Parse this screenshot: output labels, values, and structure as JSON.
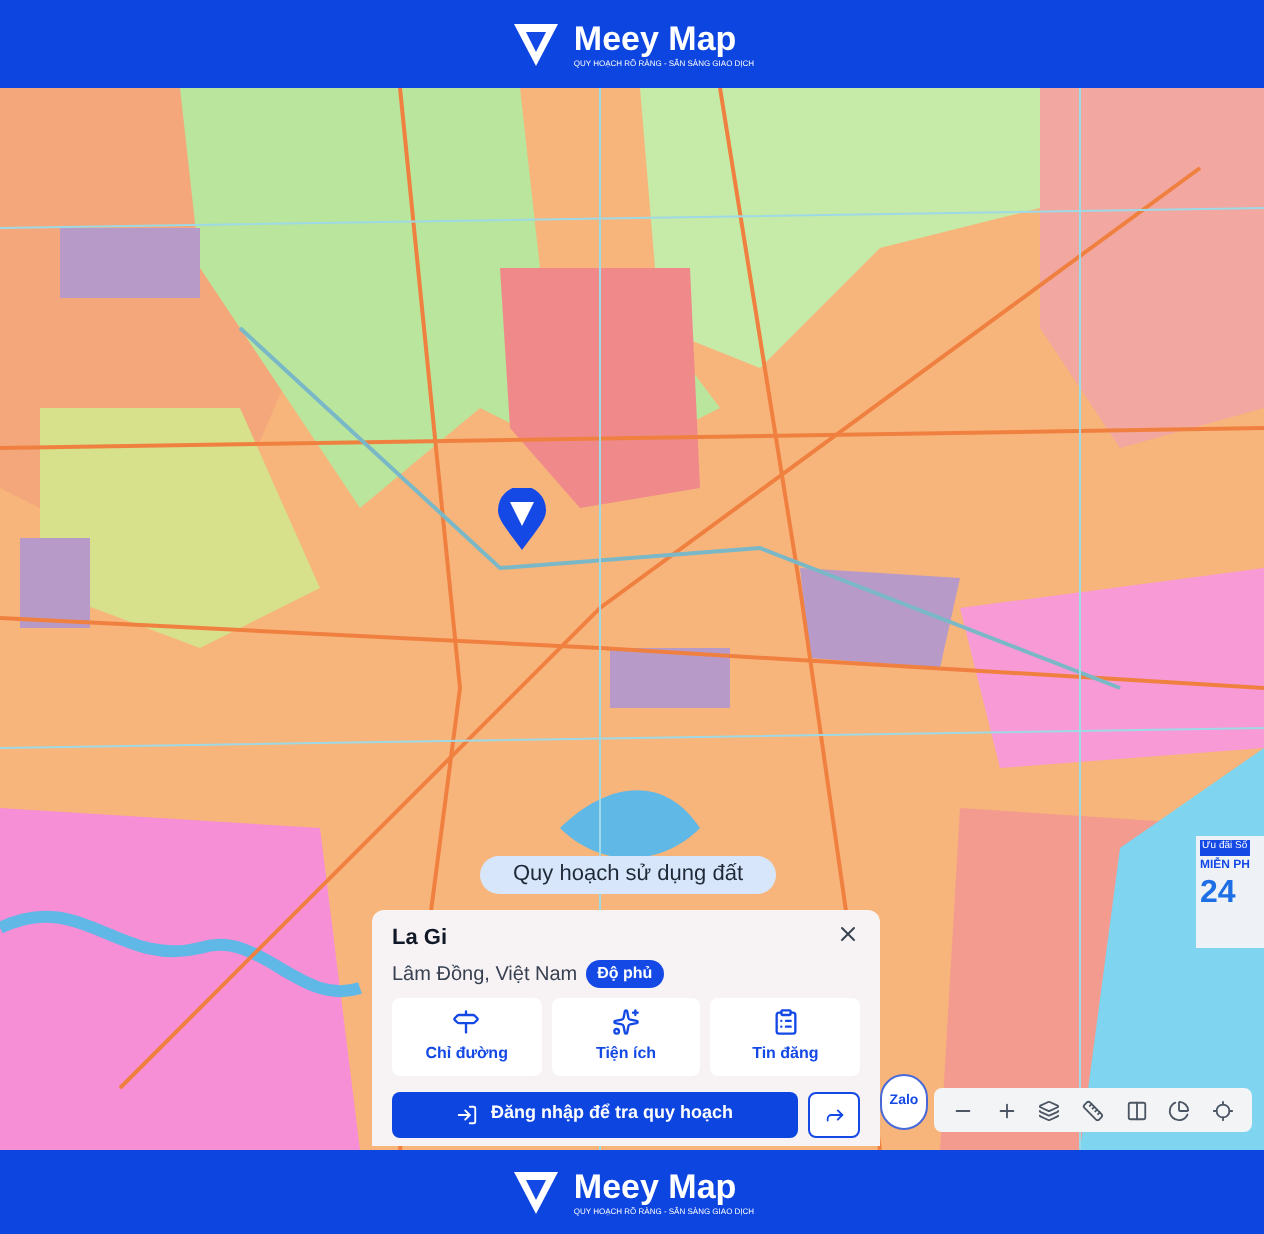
{
  "header": {
    "logo_text": "Meey Map",
    "tagline": "QUY HOẠCH RÕ RÀNG - SẴN SÀNG GIAO DỊCH"
  },
  "map": {
    "layer_label": "Quy hoạch sử dụng đất"
  },
  "place_panel": {
    "title": "La Gi",
    "subtitle": "Lâm Đồng, Việt Nam",
    "badge": "Độ phủ",
    "actions": [
      {
        "label": "Chỉ đường",
        "kind": "directions"
      },
      {
        "label": "Tiện ích",
        "kind": "utilities"
      },
      {
        "label": "Tin đăng",
        "kind": "listings"
      }
    ],
    "login_button": "Đăng nhập để tra quy hoạch"
  },
  "zalo_button": "Zalo",
  "promo": {
    "tag": "Ưu đãi Số",
    "headline": "MIỄN PH",
    "number": "24"
  },
  "footer": {
    "logo_text": "Meey Map",
    "tagline": "QUY HOẠCH RÕ RÀNG - SẴN SÀNG GIAO DỊCH"
  }
}
